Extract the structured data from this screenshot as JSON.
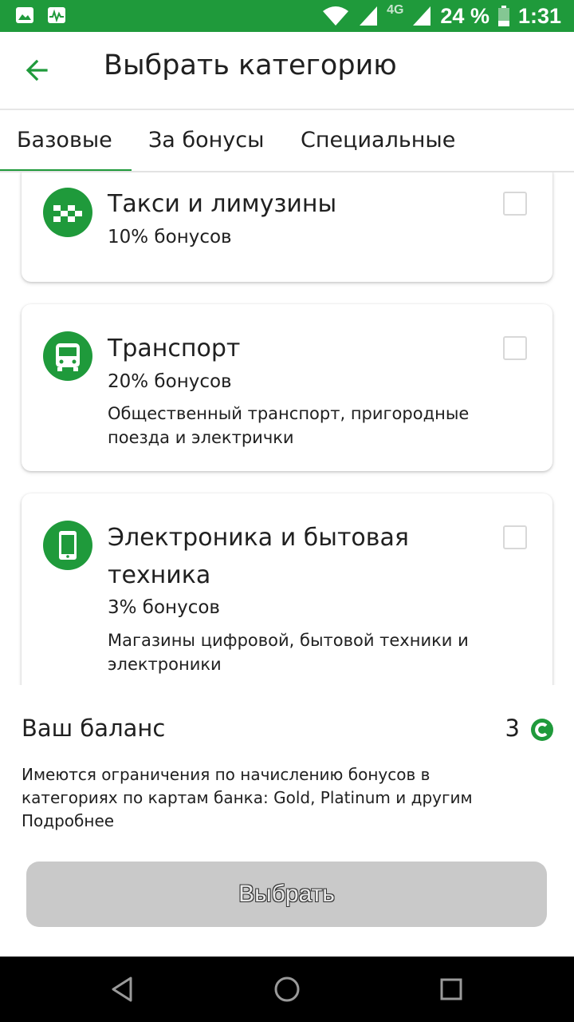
{
  "status_bar": {
    "battery": "24 %",
    "time": "1:31",
    "network": "4G",
    "icons": [
      "image-icon",
      "activity-icon",
      "wifi-icon",
      "signal-icon",
      "signal-icon-2",
      "battery-icon"
    ],
    "background": "#1f9a3b"
  },
  "header": {
    "title": "Выбрать категорию",
    "back_icon": "arrow-left-icon"
  },
  "tabs": [
    {
      "label": "Базовые",
      "active": true
    },
    {
      "label": "За бонусы",
      "active": false
    },
    {
      "label": "Специальные",
      "active": false
    }
  ],
  "categories": [
    {
      "title": "Такси и лимузины",
      "bonus": "10% бонусов",
      "description": "",
      "icon": "taxi-icon",
      "checked": false
    },
    {
      "title": "Транспорт",
      "bonus": "20% бонусов",
      "description": "Общественный транспорт, пригородные поезда и электрички",
      "icon": "bus-icon",
      "checked": false
    },
    {
      "title": "Электроника и бытовая техника",
      "bonus": "3% бонусов",
      "description": "Магазины цифровой, бытовой техники и электроники",
      "icon": "smartphone-icon",
      "checked": false
    }
  ],
  "balance": {
    "label": "Ваш баланс",
    "value": "3",
    "icon": "bonus-coin-icon"
  },
  "notice": {
    "text": "Имеются ограничения по начислению бонусов в категориях по картам банка: Gold, Platinum и другим",
    "link": "Подробнее"
  },
  "select_button": {
    "label": "Выбрать",
    "enabled": false
  },
  "nav_bar": {
    "icons": [
      "nav-back-icon",
      "nav-home-icon",
      "nav-recent-icon"
    ]
  },
  "colors": {
    "accent": "#1f9a3b",
    "button_disabled": "#c9c9c9"
  }
}
